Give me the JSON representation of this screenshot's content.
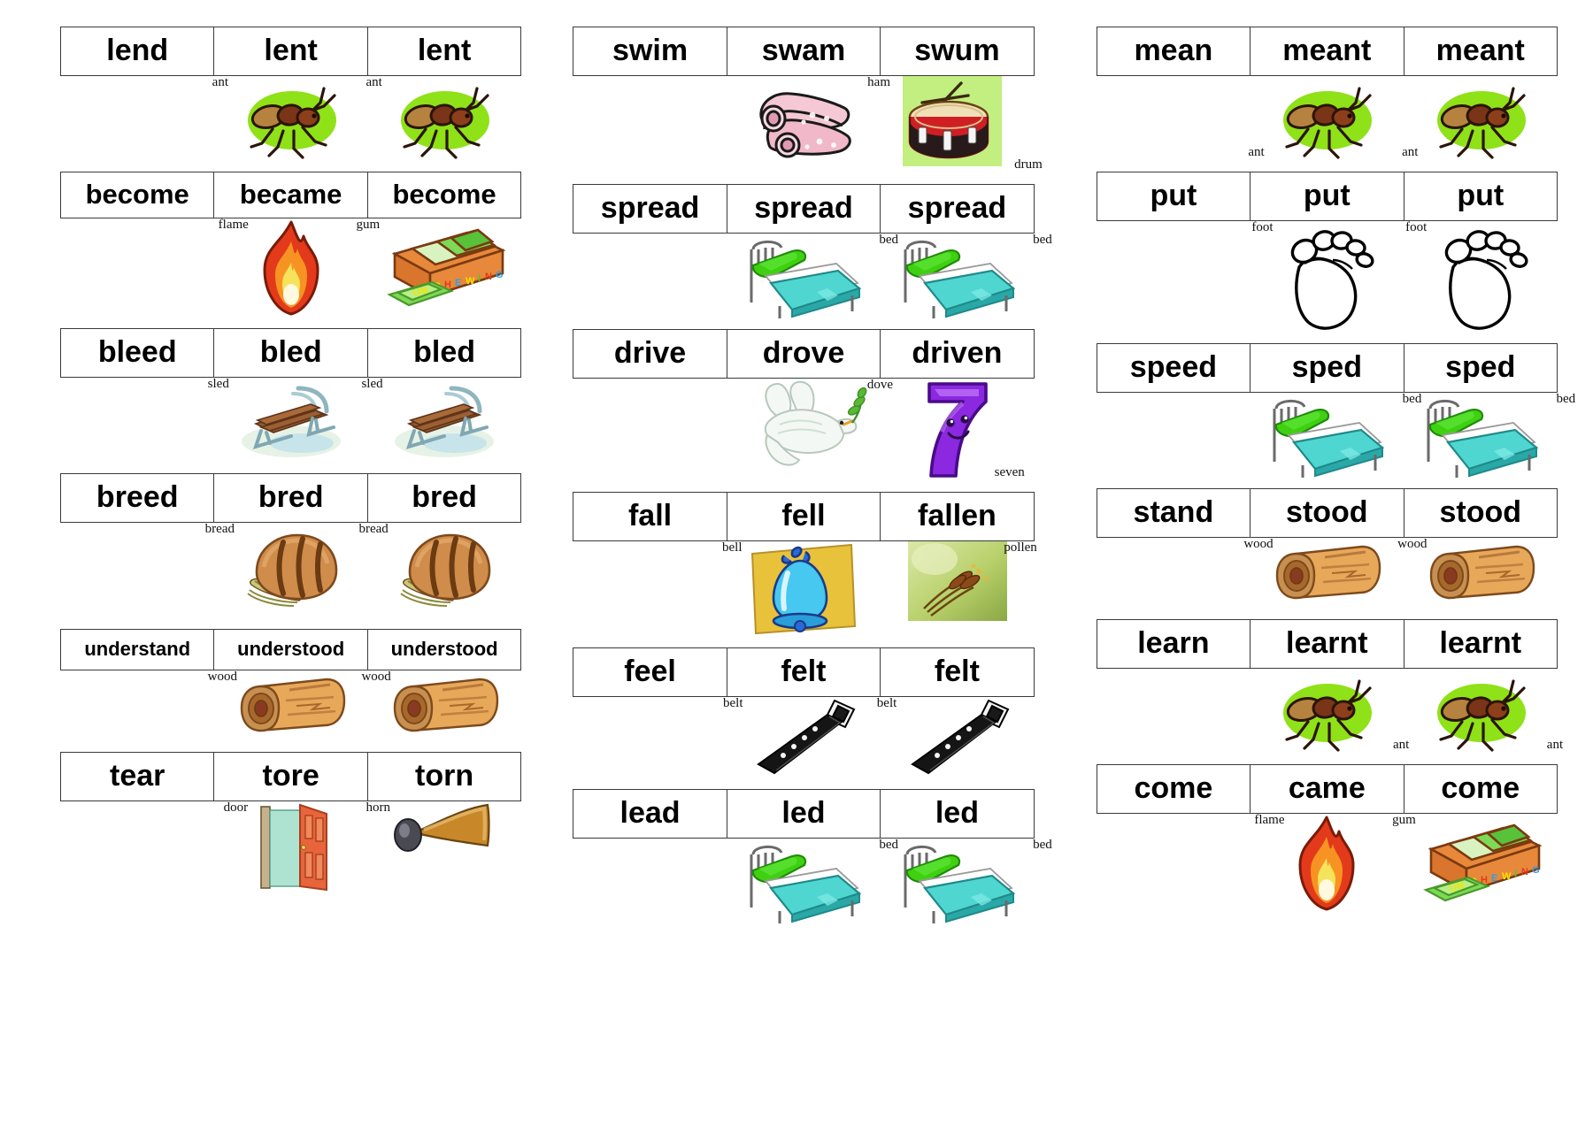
{
  "document": {
    "title": "Irregular Verbs Mnemonic Chart",
    "columns": [
      {
        "id": "column-1",
        "rows": [
          {
            "id": "lend",
            "size": "lg",
            "forms": [
              "lend",
              "lent",
              "lent"
            ],
            "pictures": [
              {
                "slot": 0,
                "icon": "none",
                "label": ""
              },
              {
                "slot": 1,
                "icon": "ant-icon",
                "label": "ant",
                "label_pos": "top-left"
              },
              {
                "slot": 2,
                "icon": "ant-icon",
                "label": "ant",
                "label_pos": "top-left"
              }
            ]
          },
          {
            "id": "become",
            "size": "md",
            "forms": [
              "become",
              "became",
              "become"
            ],
            "pictures": [
              {
                "slot": 0,
                "icon": "none",
                "label": ""
              },
              {
                "slot": 1,
                "icon": "flame-icon",
                "label": "flame",
                "label_pos": "top-left"
              },
              {
                "slot": 2,
                "icon": "gum-icon",
                "label": "gum",
                "label_pos": "top-left"
              }
            ]
          },
          {
            "id": "bleed",
            "size": "lg",
            "forms": [
              "bleed",
              "bled",
              "bled"
            ],
            "pictures": [
              {
                "slot": 0,
                "icon": "none",
                "label": ""
              },
              {
                "slot": 1,
                "icon": "sled-icon",
                "label": "sled",
                "label_pos": "top-left"
              },
              {
                "slot": 2,
                "icon": "sled-icon",
                "label": "sled",
                "label_pos": "top-left"
              }
            ]
          },
          {
            "id": "breed",
            "size": "lg",
            "forms": [
              "breed",
              "bred",
              "bred"
            ],
            "pictures": [
              {
                "slot": 0,
                "icon": "none",
                "label": ""
              },
              {
                "slot": 1,
                "icon": "bread-icon",
                "label": "bread",
                "label_pos": "top-left"
              },
              {
                "slot": 2,
                "icon": "bread-icon",
                "label": "bread",
                "label_pos": "top-left"
              }
            ]
          },
          {
            "id": "understand",
            "size": "sm",
            "forms": [
              "understand",
              "understood",
              "understood"
            ],
            "pictures": [
              {
                "slot": 0,
                "icon": "none",
                "label": ""
              },
              {
                "slot": 1,
                "icon": "wood-icon",
                "label": "wood",
                "label_pos": "top-left"
              },
              {
                "slot": 2,
                "icon": "wood-icon",
                "label": "wood",
                "label_pos": "top-left"
              }
            ]
          },
          {
            "id": "tear",
            "size": "lg",
            "forms": [
              "tear",
              "tore",
              "torn"
            ],
            "pictures": [
              {
                "slot": 0,
                "icon": "none",
                "label": ""
              },
              {
                "slot": 1,
                "icon": "door-icon",
                "label": "door",
                "label_pos": "top-left"
              },
              {
                "slot": 2,
                "icon": "horn-icon",
                "label": "horn",
                "label_pos": "top-left"
              }
            ]
          }
        ]
      },
      {
        "id": "column-2",
        "rows": [
          {
            "id": "swim",
            "size": "lg",
            "forms": [
              "swim",
              "swam",
              "swum"
            ],
            "pictures": [
              {
                "slot": 0,
                "icon": "none",
                "label": ""
              },
              {
                "slot": 1,
                "icon": "ham-icon",
                "label": "ham",
                "label_pos": "top-right"
              },
              {
                "slot": 2,
                "icon": "drum-icon",
                "label": "drum",
                "label_pos": "bottom-right"
              }
            ]
          },
          {
            "id": "spread",
            "size": "lg",
            "forms": [
              "spread",
              "spread",
              "spread"
            ],
            "pictures": [
              {
                "slot": 0,
                "icon": "none",
                "label": ""
              },
              {
                "slot": 1,
                "icon": "bed-icon",
                "label": "bed",
                "label_pos": "top-right"
              },
              {
                "slot": 2,
                "icon": "bed-icon",
                "label": "bed",
                "label_pos": "top-right"
              }
            ]
          },
          {
            "id": "drive",
            "size": "lg",
            "forms": [
              "drive",
              "drove",
              "driven"
            ],
            "pictures": [
              {
                "slot": 0,
                "icon": "none",
                "label": ""
              },
              {
                "slot": 1,
                "icon": "dove-icon",
                "label": "dove",
                "label_pos": "top-right"
              },
              {
                "slot": 2,
                "icon": "seven-icon",
                "label": "seven",
                "label_pos": "bottom-right"
              }
            ]
          },
          {
            "id": "fall",
            "size": "lg",
            "forms": [
              "fall",
              "fell",
              "fallen"
            ],
            "pictures": [
              {
                "slot": 0,
                "icon": "none",
                "label": ""
              },
              {
                "slot": 1,
                "icon": "bell-icon",
                "label": "bell",
                "label_pos": "top-left"
              },
              {
                "slot": 2,
                "icon": "pollen-icon",
                "label": "pollen",
                "label_pos": "top-right"
              }
            ]
          },
          {
            "id": "feel",
            "size": "lg",
            "forms": [
              "feel",
              "felt",
              "felt"
            ],
            "pictures": [
              {
                "slot": 0,
                "icon": "none",
                "label": ""
              },
              {
                "slot": 1,
                "icon": "belt-icon",
                "label": "belt",
                "label_pos": "top-left"
              },
              {
                "slot": 2,
                "icon": "belt-icon",
                "label": "belt",
                "label_pos": "top-left"
              }
            ]
          },
          {
            "id": "lead",
            "size": "lg",
            "forms": [
              "lead",
              "led",
              "led"
            ],
            "pictures": [
              {
                "slot": 0,
                "icon": "none",
                "label": ""
              },
              {
                "slot": 1,
                "icon": "bed-icon",
                "label": "bed",
                "label_pos": "top-right"
              },
              {
                "slot": 2,
                "icon": "bed-icon",
                "label": "bed",
                "label_pos": "top-right"
              }
            ]
          }
        ]
      },
      {
        "id": "column-3",
        "rows": [
          {
            "id": "mean",
            "size": "lg",
            "forms": [
              "mean",
              "meant",
              "meant"
            ],
            "pictures": [
              {
                "slot": 0,
                "icon": "none",
                "label": ""
              },
              {
                "slot": 1,
                "icon": "ant-icon",
                "label": "ant",
                "label_pos": "bottom-left"
              },
              {
                "slot": 2,
                "icon": "ant-icon",
                "label": "ant",
                "label_pos": "bottom-left"
              }
            ]
          },
          {
            "id": "put",
            "size": "lg",
            "forms": [
              "put",
              "put",
              "put"
            ],
            "pictures": [
              {
                "slot": 0,
                "icon": "none",
                "label": ""
              },
              {
                "slot": 1,
                "icon": "foot-icon",
                "label": "foot",
                "label_pos": "top-left"
              },
              {
                "slot": 2,
                "icon": "foot-icon",
                "label": "foot",
                "label_pos": "top-left"
              }
            ]
          },
          {
            "id": "speed",
            "size": "lg",
            "forms": [
              "speed",
              "sped",
              "sped"
            ],
            "pictures": [
              {
                "slot": 0,
                "icon": "none",
                "label": ""
              },
              {
                "slot": 1,
                "icon": "bed-icon",
                "label": "bed",
                "label_pos": "top-right"
              },
              {
                "slot": 2,
                "icon": "bed-icon",
                "label": "bed",
                "label_pos": "top-right"
              }
            ]
          },
          {
            "id": "stand",
            "size": "lg",
            "forms": [
              "stand",
              "stood",
              "stood"
            ],
            "pictures": [
              {
                "slot": 0,
                "icon": "none",
                "label": ""
              },
              {
                "slot": 1,
                "icon": "wood-icon",
                "label": "wood",
                "label_pos": "top-left"
              },
              {
                "slot": 2,
                "icon": "wood-icon",
                "label": "wood",
                "label_pos": "top-left"
              }
            ]
          },
          {
            "id": "learn",
            "size": "lg",
            "forms": [
              "learn",
              "learnt",
              "learnt"
            ],
            "pictures": [
              {
                "slot": 0,
                "icon": "none",
                "label": ""
              },
              {
                "slot": 1,
                "icon": "ant-icon",
                "label": "ant",
                "label_pos": "bottom-right"
              },
              {
                "slot": 2,
                "icon": "ant-icon",
                "label": "ant",
                "label_pos": "bottom-right"
              }
            ]
          },
          {
            "id": "come",
            "size": "lg",
            "forms": [
              "come",
              "came",
              "come"
            ],
            "pictures": [
              {
                "slot": 0,
                "icon": "none",
                "label": ""
              },
              {
                "slot": 1,
                "icon": "flame-icon",
                "label": "flame",
                "label_pos": "top-left"
              },
              {
                "slot": 2,
                "icon": "gum-icon",
                "label": "gum",
                "label_pos": "top-left"
              }
            ]
          }
        ]
      }
    ]
  },
  "palette": {
    "border": "#3a3a3a",
    "text": "#000000",
    "ant_body": "#7a3418",
    "ant_abdomen": "#b5833f",
    "ant_halo": "#8fe118",
    "flame_outer": "#e23a1b",
    "flame_mid": "#f79322",
    "flame_inner": "#f7e25b",
    "gum_box": "#e8883a",
    "gum_stick": "#7ed957",
    "bed_pillow": "#3fd111",
    "bed_blanket": "#4fd6d0",
    "bread_crust": "#d08c4a",
    "wood_light": "#e8a85a",
    "wood_dark": "#a8682c",
    "ham_pink": "#f0b8c8",
    "drum_red": "#cf1f24",
    "drum_black": "#1a1a1a",
    "seven_purple": "#8b28e0",
    "bell_blue": "#46c8f0",
    "bell_bg": "#e8c23a",
    "belt_black": "#151515",
    "door_orange": "#e8643a",
    "door_panel": "#aee3d2",
    "horn_brass": "#c8882a",
    "pollen_green": "#c5d88a",
    "foot_outline": "#000000",
    "sled_wood": "#9a5f33",
    "sled_rail": "#8fb5bd"
  }
}
